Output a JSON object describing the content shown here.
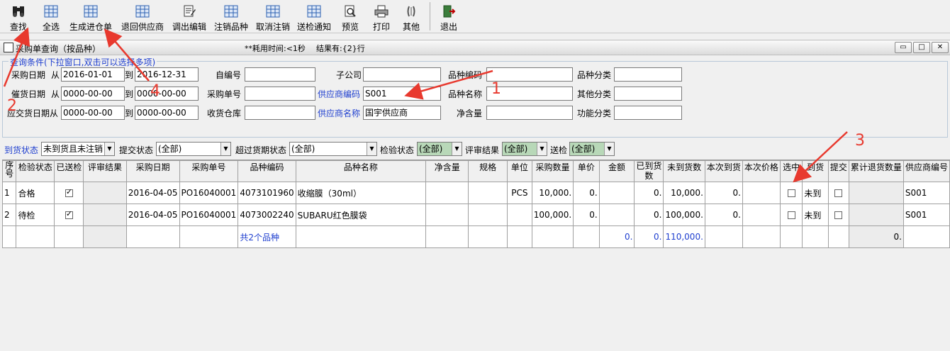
{
  "toolbar": {
    "buttons": [
      {
        "label": "查找",
        "icon": "binoculars-icon"
      },
      {
        "label": "全选",
        "icon": "grid-icon"
      },
      {
        "label": "生成进仓单",
        "icon": "grid-icon"
      },
      {
        "label": "退回供应商",
        "icon": "grid-icon"
      },
      {
        "label": "调出编辑",
        "icon": "edit-icon"
      },
      {
        "label": "注销品种",
        "icon": "grid-icon"
      },
      {
        "label": "取消注销",
        "icon": "grid-icon"
      },
      {
        "label": "送检通知",
        "icon": "grid-icon"
      },
      {
        "label": "预览",
        "icon": "preview-icon"
      },
      {
        "label": "打印",
        "icon": "printer-icon"
      },
      {
        "label": "其他",
        "icon": "other-icon"
      },
      {
        "label": "退出",
        "icon": "exit-door-icon"
      }
    ]
  },
  "window": {
    "title": "采购单查询（按品种）",
    "time_text": "**耗用时间:<1秒",
    "result_text": "结果有:{2}行",
    "btn_min": "▭",
    "btn_max": "□",
    "btn_close": "✕"
  },
  "query": {
    "legend": "查询条件(下拉窗口,双击可以选择多项)",
    "purchase_date_label": "采购日期",
    "from1": "从",
    "purchase_date_from": "2016-01-01",
    "to1": "到",
    "purchase_date_to": "2016-12-31",
    "ship_date_label": "催货日期",
    "from2": "从",
    "ship_date_from": "0000-00-00",
    "to2": "到",
    "ship_date_to": "0000-00-00",
    "due_date_label": "应交货日期从",
    "due_date_from": "0000-00-00",
    "to3": "到",
    "due_date_to": "0000-00-00",
    "self_no_label": "自编号",
    "self_no": "",
    "po_no_label": "采购单号",
    "po_no": "",
    "warehouse_label": "收货仓库",
    "warehouse": "",
    "subsidiary_label": "子公司",
    "subsidiary": "",
    "supplier_code_label": "供应商编码",
    "supplier_code": "S001",
    "supplier_name_label": "供应商名称",
    "supplier_name": "国宇供应商",
    "item_code_label": "品种编码",
    "item_code": "",
    "item_name_label": "品种名称",
    "item_name": "",
    "net_label": "净含量",
    "net": "",
    "category_label": "品种分类",
    "category": "",
    "other_category_label": "其他分类",
    "other_category": "",
    "func_category_label": "功能分类",
    "func_category": ""
  },
  "filters": {
    "arrival_label": "到货状态",
    "arrival_value": "未到货且未注销",
    "submit_label": "提交状态",
    "submit_value": "(全部)",
    "overdue_label": "超过货期状态",
    "overdue_value": "(全部)",
    "inspect_label": "检验状态",
    "inspect_value": "(全部)",
    "review_label": "评审结果",
    "review_value": "(全部)",
    "send_label": "送检",
    "send_value": "(全部)"
  },
  "grid": {
    "headers": [
      "序号",
      "检验状态",
      "已送检",
      "评审结果",
      "采购日期",
      "采购单号",
      "品种编码",
      "品种名称",
      "净含量",
      "规格",
      "单位",
      "采购数量",
      "单价",
      "金额",
      "已到货数",
      "未到货数",
      "本次到货",
      "本次价格",
      "选中",
      "到货",
      "提交",
      "累计退货数量",
      "供应商编号"
    ],
    "rows": [
      {
        "seq": "1",
        "inspect": "合格",
        "review": "",
        "date": "2016-04-05",
        "po": "PO16040001",
        "code": "4073101960",
        "name": "收缩膜（30ml）",
        "net": "",
        "spec": "",
        "unit": "PCS",
        "qty": "10,000.",
        "price": "0.",
        "amount": "",
        "arrived": "0.",
        "unarrived": "10,000.",
        "this_arrival": "0.",
        "this_price": "",
        "arrival_status": "未到",
        "returned": "",
        "supplier": "S001"
      },
      {
        "seq": "2",
        "inspect": "待检",
        "review": "",
        "date": "2016-04-05",
        "po": "PO16040001",
        "code": "4073002240",
        "name": "SUBARU红色膜袋",
        "net": "",
        "spec": "",
        "unit": "",
        "qty": "100,000.",
        "price": "0.",
        "amount": "",
        "arrived": "0.",
        "unarrived": "100,000.",
        "this_arrival": "0.",
        "this_price": "",
        "arrival_status": "未到",
        "returned": "",
        "supplier": "S001"
      }
    ],
    "summary": {
      "count_text": "共2个品种",
      "amount": "0.",
      "arrived": "0.",
      "unarrived": "110,000.",
      "returned": "0."
    }
  },
  "annotations": {
    "n1": "1",
    "n2": "2",
    "n3": "3",
    "n4": "4",
    "color": "#e8392e"
  }
}
